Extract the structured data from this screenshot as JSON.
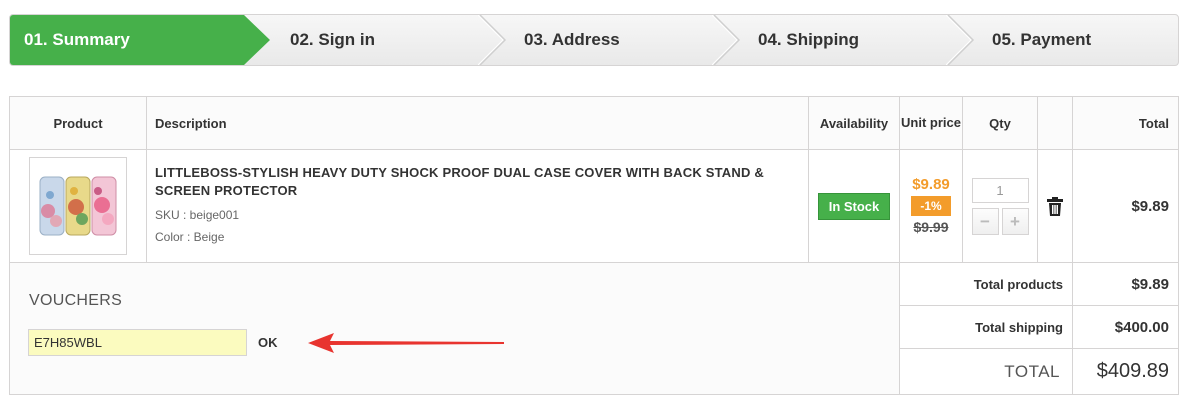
{
  "steps": [
    {
      "label": "01. Summary",
      "active": true
    },
    {
      "label": "02. Sign in",
      "active": false
    },
    {
      "label": "03. Address",
      "active": false
    },
    {
      "label": "04. Shipping",
      "active": false
    },
    {
      "label": "05. Payment",
      "active": false
    }
  ],
  "colors": {
    "active_step": "#46b04a",
    "discount": "#f39c2b",
    "voucher_bg": "#fbfbbf",
    "arrow": "#e8342f"
  },
  "table": {
    "headers": {
      "product": "Product",
      "description": "Description",
      "availability": "Availability",
      "unit_price": "Unit price",
      "qty": "Qty",
      "total": "Total"
    },
    "item": {
      "name": "LITTLEBOSS-STYLISH HEAVY DUTY SHOCK PROOF DUAL CASE COVER WITH BACK STAND & SCREEN PROTECTOR",
      "sku": "SKU : beige001",
      "color": "Color : Beige",
      "availability": "In Stock",
      "price": "$9.89",
      "discount": "-1%",
      "old_price": "$9.99",
      "qty": "1",
      "qty_minus": "−",
      "qty_plus": "+",
      "total": "$9.89",
      "delete_icon": "trash-icon"
    }
  },
  "vouchers": {
    "title": "VOUCHERS",
    "code": "E7H85WBL",
    "ok_label": "OK"
  },
  "totals": {
    "products_label": "Total products",
    "products_value": "$9.89",
    "shipping_label": "Total shipping",
    "shipping_value": "$400.00",
    "grand_label": "TOTAL",
    "grand_value": "$409.89"
  }
}
